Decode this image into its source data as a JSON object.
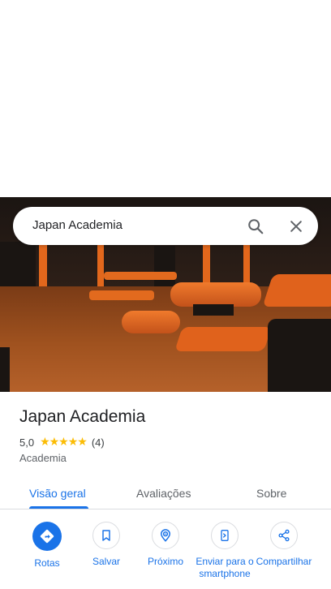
{
  "search": {
    "query": "Japan Academia"
  },
  "place": {
    "name": "Japan Academia",
    "rating": "5,0",
    "stars": "★★★★★",
    "review_count": "(4)",
    "category": "Academia"
  },
  "tabs": [
    {
      "label": "Visão geral"
    },
    {
      "label": "Avaliações"
    },
    {
      "label": "Sobre"
    }
  ],
  "actions": [
    {
      "label": "Rotas",
      "icon": "directions-icon"
    },
    {
      "label": "Salvar",
      "icon": "bookmark-icon"
    },
    {
      "label": "Próximo",
      "icon": "nearby-icon"
    },
    {
      "label": "Enviar para o smartphone",
      "icon": "send-to-phone-icon"
    },
    {
      "label": "Compartilhar",
      "icon": "share-icon"
    }
  ],
  "colors": {
    "accent": "#1a73e8",
    "star": "#fbbc04",
    "text": "#202124",
    "secondary_text": "#5f6368"
  }
}
